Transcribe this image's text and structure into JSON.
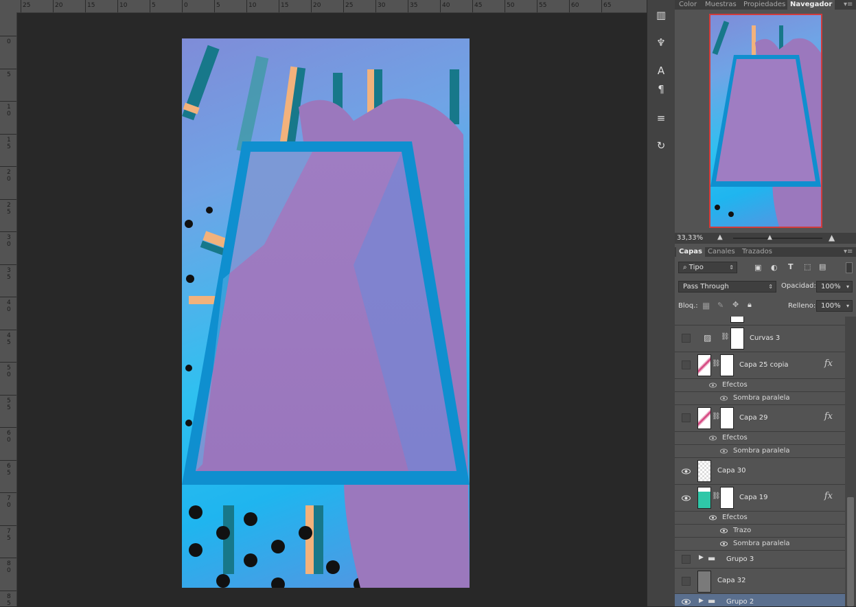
{
  "ruler": {
    "top_labels": [
      "25",
      "20",
      "15",
      "10",
      "5",
      "0",
      "5",
      "10",
      "15",
      "20",
      "25",
      "30",
      "35",
      "40",
      "45",
      "50",
      "55",
      "60",
      "65"
    ],
    "left_labels": [
      "0",
      "5",
      "1\n0",
      "1\n5",
      "2\n0",
      "2\n5",
      "3\n0",
      "3\n5",
      "4\n0",
      "4\n5",
      "5\n0",
      "5\n5",
      "6\n0",
      "6\n5",
      "7\n0",
      "7\n5",
      "8\n0",
      "8\n5"
    ]
  },
  "tools": [
    "histogram-icon",
    "brush-presets-icon",
    "character-icon",
    "paragraph-icon",
    "adjustments-icon",
    "history-icon"
  ],
  "top_panel": {
    "tabs": [
      "Color",
      "Muestras",
      "Propiedades",
      "Navegador"
    ],
    "active_tab": "Navegador",
    "zoom": "33,33%"
  },
  "layers_panel": {
    "tabs": [
      "Capas",
      "Canales",
      "Trazados"
    ],
    "active_tab": "Capas",
    "filter_label": "Tipo",
    "blend_mode": "Pass Through",
    "opacity_label": "Opacidad:",
    "opacity_value": "100%",
    "lock_label": "Bloq.:",
    "fill_label": "Relleno:",
    "fill_value": "100%",
    "layers": [
      {
        "name": "Curvas 3",
        "visible": false
      },
      {
        "name": "Capa 25 copia",
        "visible": false,
        "fx": "fx",
        "effects_label": "Efectos",
        "effects": [
          "Sombra paralela"
        ]
      },
      {
        "name": "Capa 29",
        "visible": false,
        "fx": "fx",
        "effects_label": "Efectos",
        "effects": [
          "Sombra paralela"
        ]
      },
      {
        "name": "Capa 30",
        "visible": true
      },
      {
        "name": "Capa 19",
        "visible": true,
        "fx": "fx",
        "effects_label": "Efectos",
        "effects": [
          "Trazo",
          "Sombra paralela"
        ]
      },
      {
        "name": "Grupo 3",
        "visible": false
      },
      {
        "name": "Capa 32",
        "visible": false
      },
      {
        "name": "Grupo 2",
        "visible": true,
        "selected": true
      }
    ]
  },
  "colors": {
    "panel_bg": "#535353",
    "selected_row": "#5a6f8e",
    "navigator_frame": "#d23b3b",
    "canvas_bg": "#282828"
  }
}
